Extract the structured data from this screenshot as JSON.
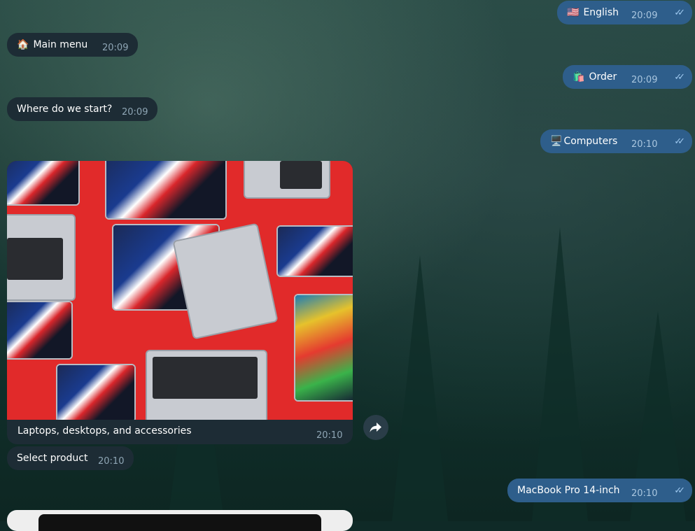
{
  "messages": [
    {
      "side": "out",
      "emoji": "🇺🇸",
      "text": "English",
      "time": "20:09"
    },
    {
      "side": "in",
      "emoji": "🏠",
      "text": "Main menu",
      "time": "20:09"
    },
    {
      "side": "out",
      "emoji": "🛍️",
      "text": "Order",
      "time": "20:09"
    },
    {
      "side": "in",
      "text": "Where do we start?",
      "time": "20:09"
    },
    {
      "side": "out",
      "emoji": "🖥️",
      "text": "Computers",
      "time": "20:10"
    },
    {
      "side": "in",
      "type": "photo",
      "caption": "Laptops, desktops, and accessories",
      "time": "20:10"
    },
    {
      "side": "in",
      "text": "Select product",
      "time": "20:10"
    },
    {
      "side": "out",
      "text": "MacBook Pro 14-inch",
      "time": "20:10"
    }
  ],
  "icons": {
    "read_receipt": "double-check-icon",
    "forward": "forward-arrow-icon"
  },
  "colors": {
    "incoming_bubble": "#1d2c35",
    "outgoing_bubble": "#2e5e8b",
    "photo_background": "#e12a2a"
  }
}
